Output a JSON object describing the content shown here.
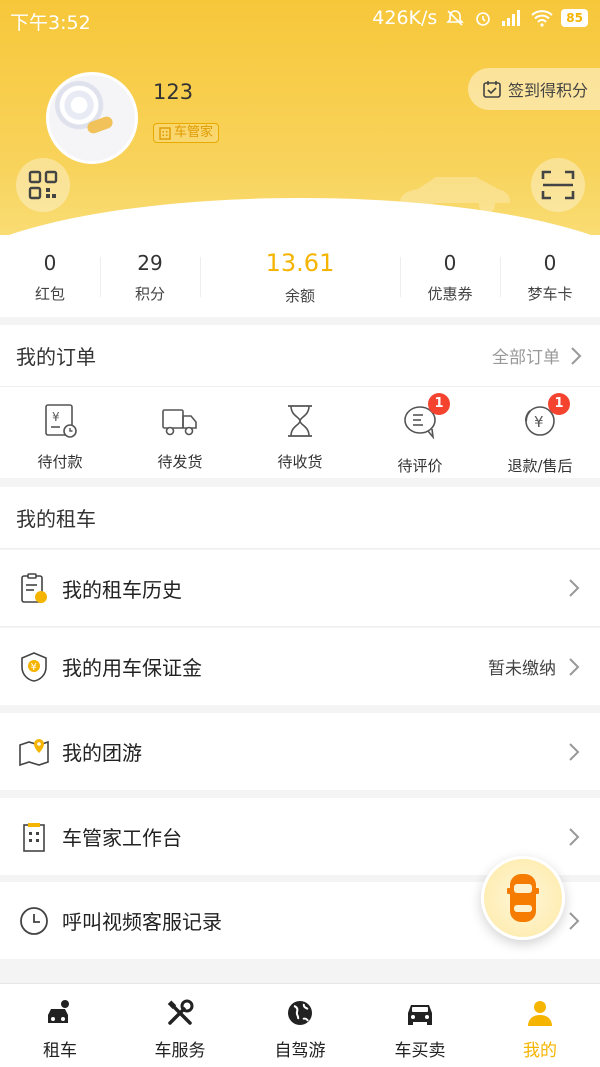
{
  "status_bar": {
    "time": "下午3:52",
    "speed": "426K/s",
    "battery": "85"
  },
  "profile": {
    "username": "123",
    "role": "车管家",
    "checkin": "签到得积分"
  },
  "stats": [
    {
      "value": "0",
      "label": "红包"
    },
    {
      "value": "29",
      "label": "积分"
    },
    {
      "value": "13.61",
      "label": "余额"
    },
    {
      "value": "0",
      "label": "优惠券"
    },
    {
      "value": "0",
      "label": "梦车卡"
    }
  ],
  "orders": {
    "title": "我的订单",
    "all_label": "全部订单",
    "items": [
      {
        "label": "待付款",
        "badge": ""
      },
      {
        "label": "待发货",
        "badge": ""
      },
      {
        "label": "待收货",
        "badge": ""
      },
      {
        "label": "待评价",
        "badge": "1"
      },
      {
        "label": "退款/售后",
        "badge": "1"
      }
    ]
  },
  "rental": {
    "title": "我的租车",
    "history": "我的租车历史",
    "deposit": "我的用车保证金",
    "deposit_status": "暂未缴纳"
  },
  "menu": {
    "group_tour": "我的团游",
    "workbench": "车管家工作台",
    "video_service": "呼叫视频客服记录"
  },
  "tabs": [
    {
      "label": "租车"
    },
    {
      "label": "车服务"
    },
    {
      "label": "自驾游"
    },
    {
      "label": "车买卖"
    },
    {
      "label": "我的"
    }
  ],
  "colors": {
    "accent": "#f4b400",
    "header": "#f7c73a",
    "badge": "#f4432f"
  }
}
